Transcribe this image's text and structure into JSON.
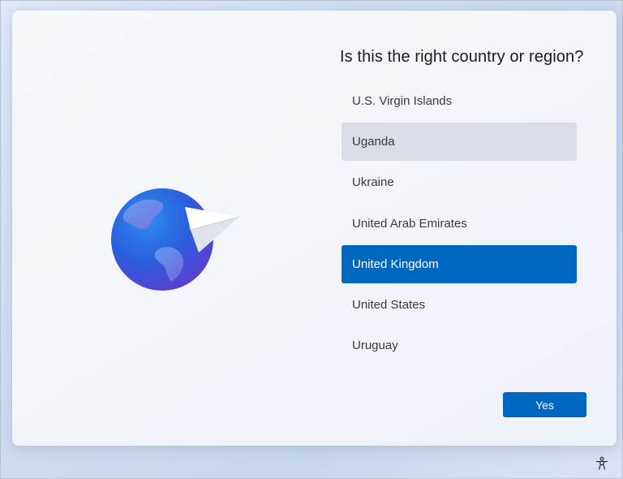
{
  "dialog": {
    "title": "Is this the right country or region?"
  },
  "countries": {
    "items": [
      {
        "label": "U.S. Virgin Islands",
        "state": "normal"
      },
      {
        "label": "Uganda",
        "state": "hover"
      },
      {
        "label": "Ukraine",
        "state": "normal"
      },
      {
        "label": "United Arab Emirates",
        "state": "normal"
      },
      {
        "label": "United Kingdom",
        "state": "selected"
      },
      {
        "label": "United States",
        "state": "normal"
      },
      {
        "label": "Uruguay",
        "state": "normal"
      }
    ]
  },
  "actions": {
    "yes_label": "Yes"
  },
  "icons": {
    "illustration": "globe-with-paper-plane-icon",
    "accessibility": "accessibility-icon"
  },
  "colors": {
    "accent": "#0067c0",
    "hover": "#d9dde5"
  }
}
